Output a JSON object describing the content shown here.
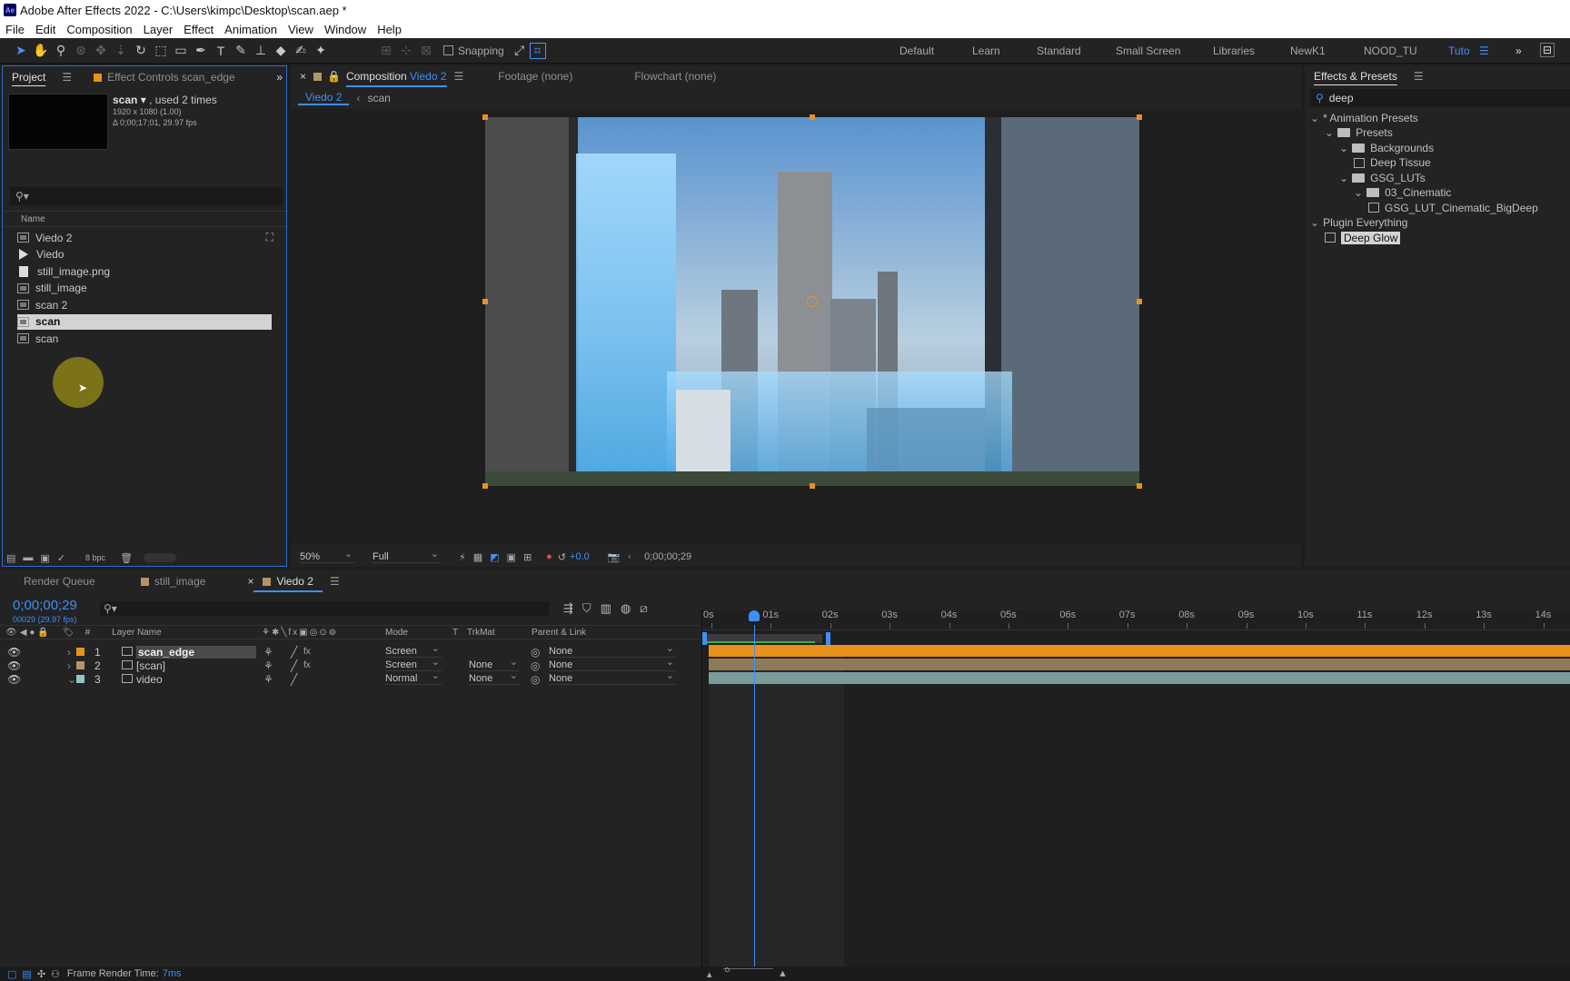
{
  "title": "Adobe After Effects 2022 - C:\\Users\\kimpc\\Desktop\\scan.aep *",
  "menu": [
    "File",
    "Edit",
    "Composition",
    "Layer",
    "Effect",
    "Animation",
    "View",
    "Window",
    "Help"
  ],
  "toolbar": {
    "snapping_label": "Snapping",
    "workspaces": [
      "Default",
      "Learn",
      "Standard",
      "Small Screen",
      "Libraries",
      "NewK1",
      "NOOD_TU",
      "Tuto"
    ],
    "active_workspace": "Tuto"
  },
  "project": {
    "tab_project": "Project",
    "tab_effect_controls": "Effect Controls scan_edge",
    "selected_name": "scan",
    "used_times": ", used 2 times",
    "dims": "1920 x 1080 (1.00)",
    "duration": "Δ 0;00;17;01, 29.97 fps",
    "search_placeholder": "",
    "column_name": "Name",
    "items": [
      {
        "name": "Viedo 2",
        "type": "comp"
      },
      {
        "name": "Viedo",
        "type": "video"
      },
      {
        "name": "still_image.png",
        "type": "file"
      },
      {
        "name": "still_image",
        "type": "comp"
      },
      {
        "name": "scan 2",
        "type": "comp"
      },
      {
        "name": "scan",
        "type": "comp",
        "selected": true
      },
      {
        "name": "scan",
        "type": "comp"
      }
    ],
    "bpc": "8 bpc"
  },
  "composition": {
    "tab_close": "×",
    "tab_label": "Composition",
    "tab_comp_name": "Viedo 2",
    "tab_footage": "Footage (none)",
    "tab_flowchart": "Flowchart (none)",
    "breadcrumb_active": "Viedo 2",
    "breadcrumb_next": "scan",
    "zoom": "50%",
    "resolution": "Full",
    "exposure": "+0.0",
    "timecode": "0;00;00;29"
  },
  "effects": {
    "title": "Effects & Presets",
    "search_value": "deep",
    "tree": [
      {
        "label": "* Animation Presets",
        "indent": 0,
        "kind": "group"
      },
      {
        "label": "Presets",
        "indent": 1,
        "kind": "folder"
      },
      {
        "label": "Backgrounds",
        "indent": 2,
        "kind": "folder"
      },
      {
        "label": "Deep Tissue",
        "indent": 3,
        "kind": "preset"
      },
      {
        "label": "GSG_LUTs",
        "indent": 2,
        "kind": "folder"
      },
      {
        "label": "03_Cinematic",
        "indent": 3,
        "kind": "folder"
      },
      {
        "label": "GSG_LUT_Cinematic_BigDeep",
        "indent": 4,
        "kind": "preset"
      },
      {
        "label": "Plugin Everything",
        "indent": 0,
        "kind": "group"
      },
      {
        "label": "Deep Glow",
        "indent": 1,
        "kind": "effect",
        "selected": true
      }
    ]
  },
  "timeline": {
    "tab_render_queue": "Render Queue",
    "tab_still_image": "still_image",
    "tab_close": "×",
    "tab_active": "Viedo 2",
    "timecode": "0;00;00;29",
    "frame_info": "00029 (29.97 fps)",
    "columns": {
      "hash": "#",
      "layer_name": "Layer Name",
      "mode": "Mode",
      "t": "T",
      "trkmat": "TrkMat",
      "parent": "Parent & Link"
    },
    "layers": [
      {
        "num": "1",
        "name": "scan_edge",
        "mode": "Screen",
        "trkmat": "",
        "parent": "None",
        "color": "#e8921c"
      },
      {
        "num": "2",
        "name": "[scan]",
        "mode": "Screen",
        "trkmat": "None",
        "parent": "None",
        "color": "#b39466"
      },
      {
        "num": "3",
        "name": "video",
        "mode": "Normal",
        "trkmat": "None",
        "parent": "None",
        "color": "#8fc7c7"
      }
    ],
    "ruler": [
      "0s",
      "01s",
      "02s",
      "03s",
      "04s",
      "05s",
      "06s",
      "07s",
      "08s",
      "09s",
      "10s",
      "11s",
      "12s",
      "13s",
      "14s"
    ],
    "current_time_fraction": 0.0567
  },
  "status": {
    "label": "Frame Render Time:",
    "value": "7ms"
  },
  "colors": {
    "accent": "#3e8ef7",
    "layer1": "#e8921c"
  }
}
